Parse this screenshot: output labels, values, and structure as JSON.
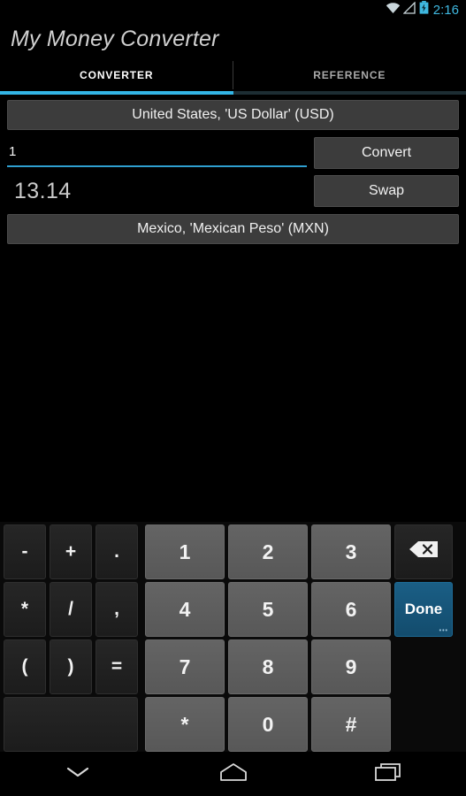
{
  "status_bar": {
    "time": "2:16",
    "icons": [
      "wifi-icon",
      "signal-icon",
      "battery-charging-icon"
    ],
    "accent_color": "#3fb8e0"
  },
  "app": {
    "title": "My Money Converter",
    "accent_color": "#33b5e5"
  },
  "tabs": [
    {
      "label": "CONVERTER",
      "active": true
    },
    {
      "label": "REFERENCE",
      "active": false
    }
  ],
  "converter": {
    "from_currency": "United States, 'US Dollar' (USD)",
    "to_currency": "Mexico, 'Mexican Peso' (MXN)",
    "amount_value": "1",
    "amount_placeholder": "",
    "result_value": "13.14",
    "convert_label": "Convert",
    "swap_label": "Swap"
  },
  "keyboard": {
    "rows": [
      {
        "symbols": [
          "-",
          "+",
          "."
        ],
        "numbers": [
          "1",
          "2",
          "3"
        ],
        "function": {
          "label": "",
          "icon": "backspace-icon",
          "type": "backspace"
        }
      },
      {
        "symbols": [
          "*",
          "/",
          ","
        ],
        "numbers": [
          "4",
          "5",
          "6"
        ],
        "function": {
          "label": "Done",
          "icon": "",
          "type": "done"
        }
      },
      {
        "symbols": [
          "(",
          ")",
          "="
        ],
        "numbers": [
          "7",
          "8",
          "9"
        ],
        "function": {
          "label": "",
          "icon": "",
          "type": "empty"
        }
      },
      {
        "symbols": [
          ""
        ],
        "numbers": [
          "*",
          "0",
          "#"
        ],
        "function": {
          "label": "",
          "icon": "",
          "type": "empty"
        }
      }
    ],
    "done_color": "#17557a"
  },
  "nav_bar": {
    "buttons": [
      {
        "name": "hide-keyboard-button",
        "icon": "chevron-down-icon"
      },
      {
        "name": "home-button",
        "icon": "home-icon"
      },
      {
        "name": "recents-button",
        "icon": "recents-icon"
      }
    ]
  }
}
